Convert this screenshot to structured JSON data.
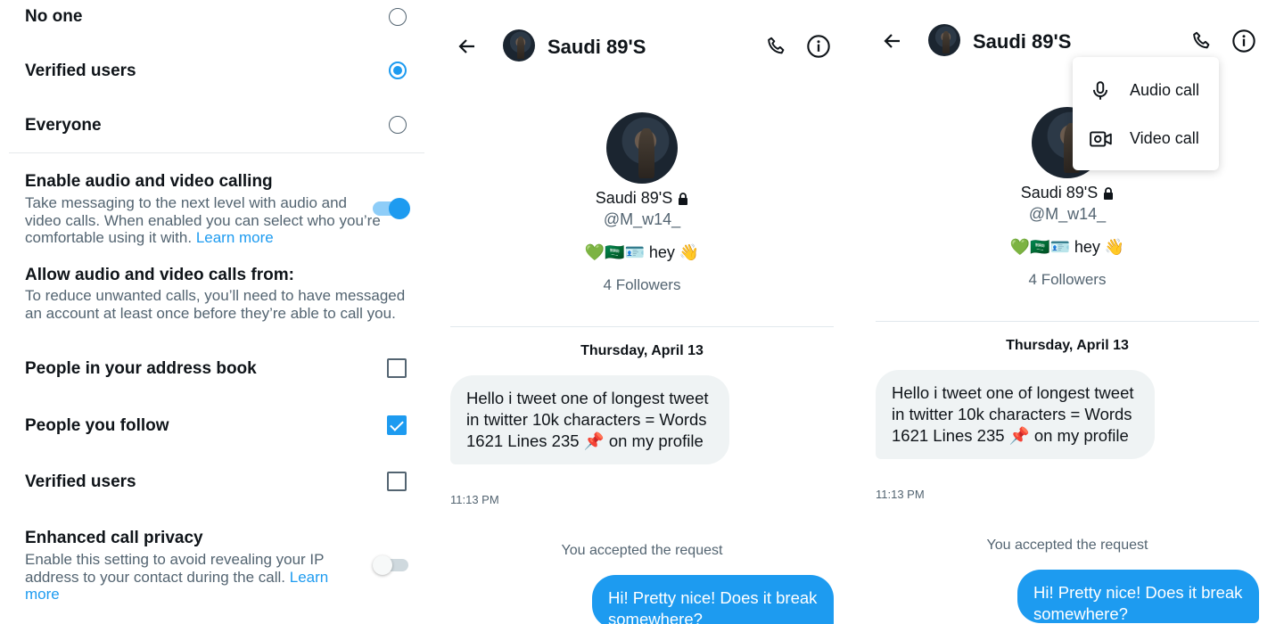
{
  "settings": {
    "message_options": [
      {
        "label": "No one",
        "selected": false
      },
      {
        "label": "Verified users",
        "selected": true
      },
      {
        "label": "Everyone",
        "selected": false
      }
    ],
    "calling": {
      "title": "Enable audio and video calling",
      "desc": "Take messaging to the next level with audio and video calls. When enabled you can select who you’re comfortable using it with. ",
      "link": "Learn more",
      "enabled": true
    },
    "allow": {
      "title": "Allow audio and video calls from:",
      "desc": "To reduce unwanted calls, you’ll need to have messaged an account at least once before they’re able to call you."
    },
    "call_options": [
      {
        "label": "People in your address book",
        "checked": false
      },
      {
        "label": "People you follow",
        "checked": true
      },
      {
        "label": "Verified users",
        "checked": false
      }
    ],
    "privacy": {
      "title": "Enhanced call privacy",
      "desc": "Enable this setting to avoid revealing your IP address to your contact during the call. ",
      "link": "Learn more",
      "enabled": false
    }
  },
  "chat": {
    "contact_name": "Saudi 89'S",
    "profile_name": "Saudi 89'S",
    "handle": "@M_w14_",
    "bio": "💚🇸🇦🪪 hey 👋",
    "followers": "4 Followers",
    "date": "Thursday, April 13",
    "incoming": "Hello i tweet one of longest tweet in twitter 10k characters =  Words 1621 Lines 235 📌 on my profile",
    "time": "11:13 PM",
    "system": "You accepted the request",
    "outgoing": "Hi! Pretty nice! Does it break somewhere?"
  },
  "menu": {
    "audio": "Audio call",
    "video": "Video call"
  },
  "colors": {
    "accent": "#1d9bf0",
    "bubble_in": "#eff3f4",
    "muted_text": "#536471"
  }
}
